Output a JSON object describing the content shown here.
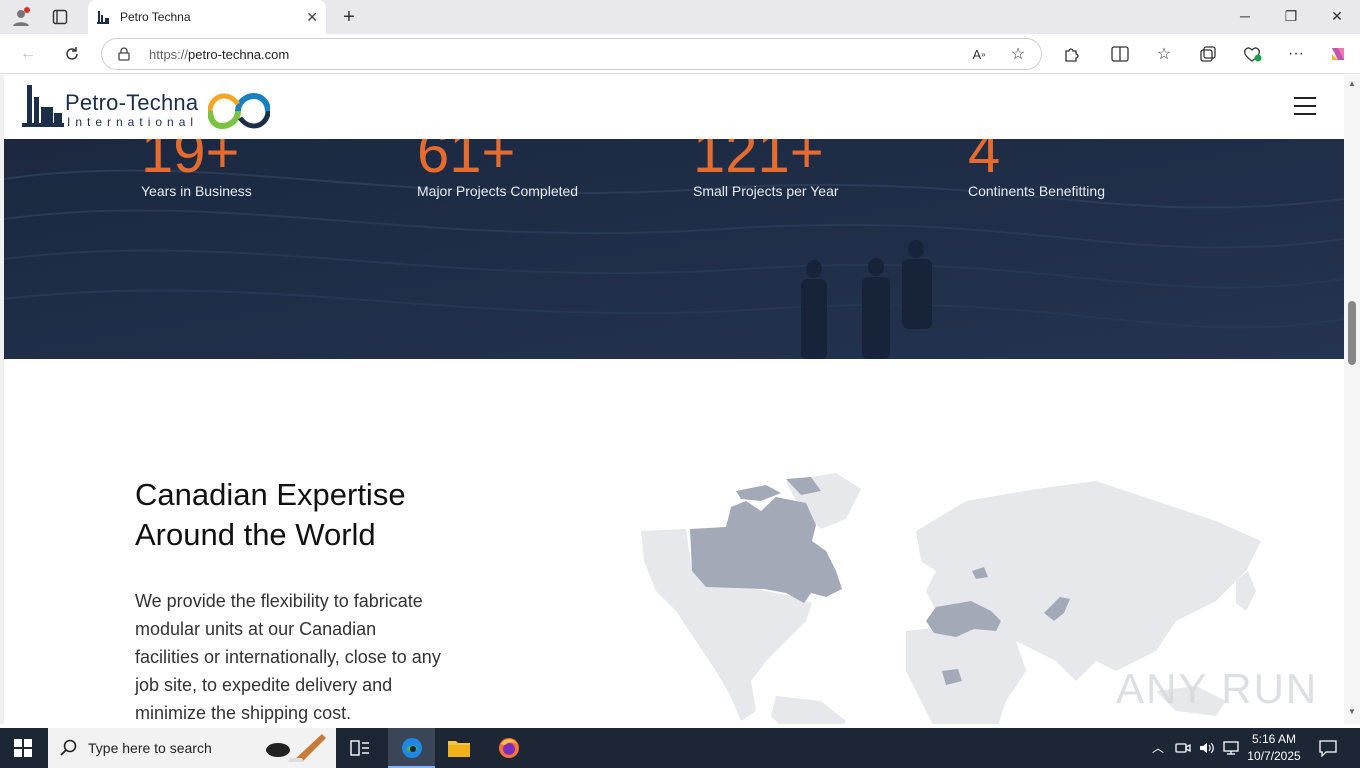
{
  "browser": {
    "tab_title": "Petro Techna",
    "url_protocol": "https://",
    "url_host": "petro-techna.com",
    "new_tab_symbol": "+"
  },
  "site": {
    "logo_main": "Petro-Techna",
    "logo_sub": "International",
    "colors": {
      "navy": "#1c2e4a",
      "orange": "#e76b2d",
      "green": "#7cc242",
      "blue": "#1a7fc1"
    }
  },
  "stats": [
    {
      "number": "19+",
      "label": "Years in Business"
    },
    {
      "number": "61+",
      "label": "Major Projects Completed"
    },
    {
      "number": "121+",
      "label": "Small Projects per Year"
    },
    {
      "number": "4",
      "label": "Continents Benefitting"
    }
  ],
  "expertise": {
    "title_line1": "Canadian Expertise",
    "title_line2": "Around the World",
    "body": "We provide the flexibility to fabricate modular units at our Canadian facilities or internationally, close to any job site, to expedite delivery and minimize the shipping cost."
  },
  "watermark": "ANY RUN",
  "taskbar": {
    "search_placeholder": "Type here to search",
    "time": "5:16 AM",
    "date": "10/7/2025"
  }
}
